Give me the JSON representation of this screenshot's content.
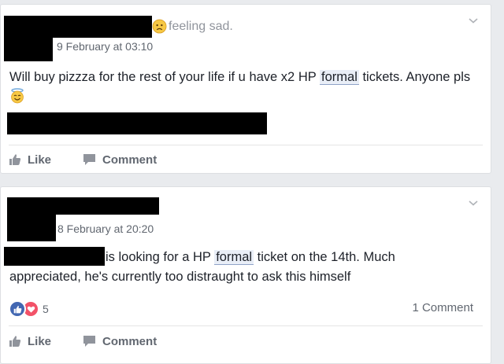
{
  "posts": [
    {
      "feeling": "feeling sad.",
      "date": "9 February at 03:10",
      "text_before": "Will buy pizzza for the rest of your life if u have x2 HP ",
      "highlight": "formal",
      "text_after": " tickets. Anyone pls",
      "like_label": "Like",
      "comment_label": "Comment"
    },
    {
      "date": "8 February at 20:20",
      "line1_before": "is looking for a HP ",
      "highlight": "formal",
      "line1_after": " ticket on the 14th. Much",
      "line2": "appreciated, he's currently too distraught to ask this himself",
      "reaction_count": "5",
      "comment_count": "1 Comment",
      "like_label": "Like",
      "comment_label": "Comment"
    }
  ],
  "icons": {
    "chevron": "chevron-down-icon",
    "like": "thumbs-up-icon",
    "comment": "comment-bubble-icon",
    "sad": "sad-face-icon",
    "angel": "smiling-halo-icon"
  },
  "colors": {
    "like_blue": "#4267b2",
    "love_red": "#f25268",
    "link_highlight": "#e9eef7"
  }
}
